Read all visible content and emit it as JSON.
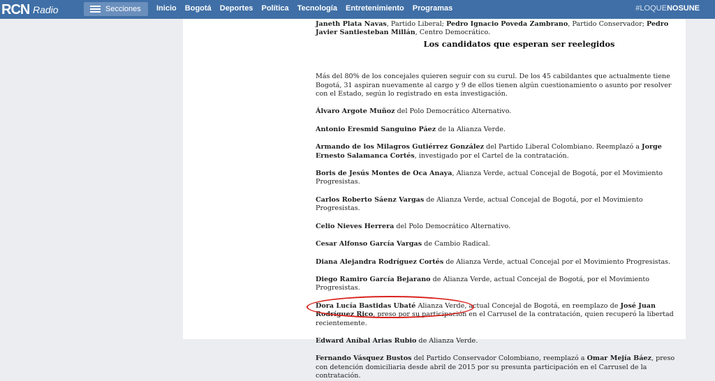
{
  "header": {
    "logo_text": "RCN",
    "logo_sub": "Radio",
    "sections_label": "Secciones",
    "nav": [
      "Inicio",
      "Bogotá",
      "Deportes",
      "Política",
      "Tecnología",
      "Entretenimiento",
      "Programas"
    ],
    "hashtag_prefix": "#LOQUE",
    "hashtag_suffix": "NOSUNE"
  },
  "article": {
    "intro": {
      "n1": "Janeth Plata Navas",
      "t1": ", Partido Liberal; ",
      "n2": "Pedro Ignacio Poveda Zambrano",
      "t2": ", Partido Conservador; ",
      "n3": "Pedro Javier Santiesteban Millán",
      "t3": ", Centro Democrático."
    },
    "subheading": "Los candidatos que esperan ser reelegidos",
    "paragraph": "Más del 80% de los concejales quieren seguir con su curul. De los 45 cabildantes que actualmente tiene Bogotá, 31 aspiran nuevamente al cargo y 9 de ellos tienen algún cuestionamiento o asunto por resolver con el Estado, según lo registrado en esta investigación.",
    "entries": [
      {
        "name": "Álvaro Argote Muñoz",
        "text": " del Polo Democrático Alternativo."
      },
      {
        "name": "Antonio Eresmid Sanguino Páez",
        "text": " de la Alianza Verde."
      },
      {
        "name": "Armando de los Milagros Gutiérrez González",
        "text": " del Partido Liberal Colombiano. Reemplazó a ",
        "name2": "Jorge Ernesto Salamanca Cortés",
        "text2": ", investigado por el Cartel de la contratación."
      },
      {
        "name": "Boris de Jesús Montes de Oca Anaya",
        "text": ", Alianza Verde, actual Concejal de Bogotá, por el Movimiento Progresistas."
      },
      {
        "name": "Carlos Roberto Sáenz Vargas",
        "text": " de Alianza Verde, actual Concejal de Bogotá, por el Movimiento Progresistas."
      },
      {
        "name": "Celio Nieves Herrera",
        "text": " del Polo Democrático Alternativo."
      },
      {
        "name": "Cesar Alfonso García Vargas",
        "text": " de Cambio Radical."
      },
      {
        "name": "Diana Alejandra Rodríguez Cortés",
        "text": " de Alianza Verde, actual Concejal por el Movimiento Progresistas."
      },
      {
        "name": "Diego Ramiro García Bejarano",
        "text": " de Alianza Verde, actual Concejal de Bogotá, por el Movimiento Progresistas."
      },
      {
        "name": "Dora Lucía Bastidas Ubaté",
        "text": " Alianza Verde, actual Concejal de Bogotá, en reemplazo de ",
        "name2": "José Juan Rodríguez Rico",
        "text2": ", preso por su participación en el Carrusel de la contratación, quien recuperó la libertad recientemente."
      },
      {
        "name": "Edward Aníbal Arias Rubio",
        "text": " de Alianza Verde."
      },
      {
        "name": "Fernando Vásquez Bustos",
        "text": " del Partido Conservador Colombiano, reemplazó a ",
        "name2": "Omar Mejía Báez",
        "text2": ", preso con detención domiciliaria desde abril de 2015 por su presunta participación en el Carrusel de la contratación."
      }
    ]
  },
  "colors": {
    "nav_bg": "#3f6fa6",
    "highlight_ring": "#d9221c"
  }
}
